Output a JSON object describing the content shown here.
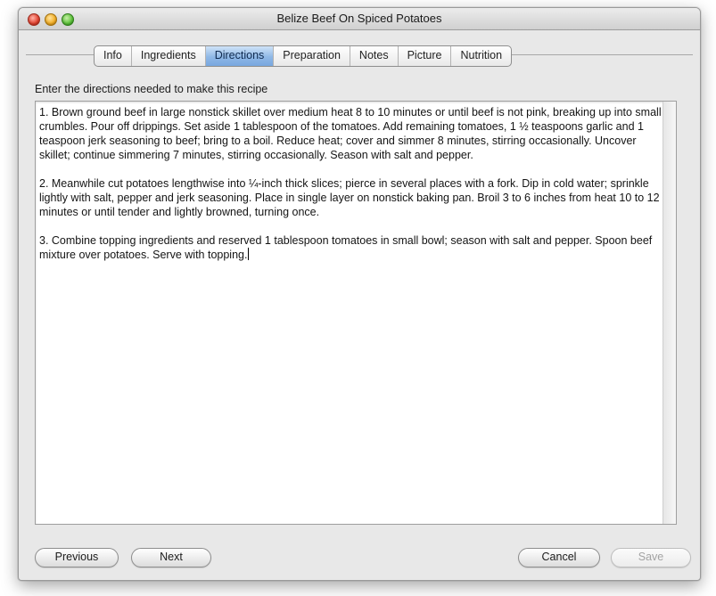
{
  "window": {
    "title": "Belize Beef On Spiced Potatoes"
  },
  "tabs": [
    {
      "label": "Info"
    },
    {
      "label": "Ingredients"
    },
    {
      "label": "Directions"
    },
    {
      "label": "Preparation"
    },
    {
      "label": "Notes"
    },
    {
      "label": "Picture"
    },
    {
      "label": "Nutrition"
    }
  ],
  "selected_tab": "Directions",
  "directions": {
    "prompt": "Enter the directions needed to make this recipe",
    "steps": [
      "1. Brown ground beef in large nonstick skillet over medium heat 8 to 10 minutes or until beef is not pink, breaking up into small crumbles. Pour off drippings. Set aside 1 tablespoon of the tomatoes. Add remaining tomatoes, 1 ½ teaspoons garlic and 1 teaspoon jerk seasoning to beef; bring to a boil. Reduce heat; cover and simmer 8 minutes, stirring occasionally. Uncover skillet; continue simmering 7 minutes, stirring occasionally. Season with salt and pepper.",
      "2. Meanwhile cut potatoes lengthwise into ¼-inch thick slices; pierce in several places with a fork. Dip in cold water; sprinkle lightly with salt, pepper and jerk seasoning. Place in single layer on nonstick baking pan. Broil 3 to 6 inches from heat 10 to 12 minutes or until tender and lightly browned, turning once.",
      "3. Combine topping ingredients and reserved 1 tablespoon tomatoes in small bowl; season with salt and pepper. Spoon beef mixture over potatoes. Serve with topping."
    ]
  },
  "buttons": {
    "previous": "Previous",
    "next": "Next",
    "cancel": "Cancel",
    "save": "Save"
  },
  "icons": {
    "close": "close-icon",
    "minimize": "minimize-icon",
    "zoom": "zoom-icon"
  }
}
